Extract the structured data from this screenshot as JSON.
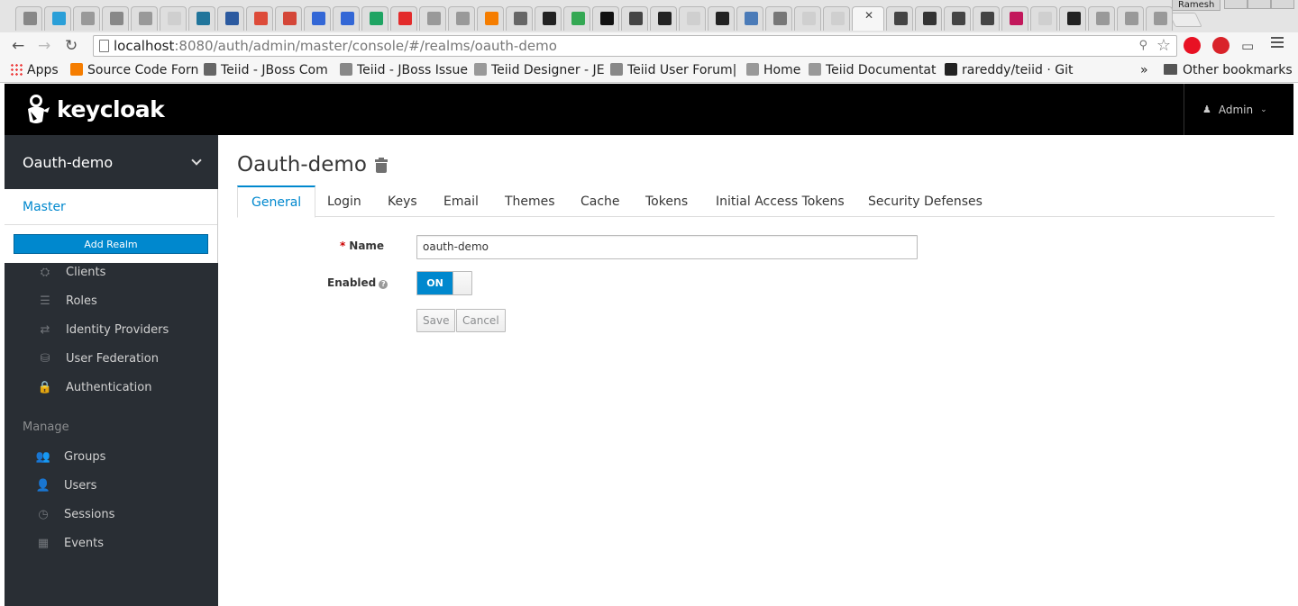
{
  "browser": {
    "profile_name": "Ramesh",
    "tabs": [
      {
        "icon": "jboss-dev-icon",
        "color": "#888888"
      },
      {
        "icon": "zoho-icon",
        "color": "#2a9fd8"
      },
      {
        "icon": "jboss-org-icon",
        "color": "#999999"
      },
      {
        "icon": "jboss-dev-icon",
        "color": "#888888"
      },
      {
        "icon": "jboss-org-icon",
        "color": "#999999"
      },
      {
        "icon": "page-icon",
        "color": "#cfcfcf"
      },
      {
        "icon": "wordpress-icon",
        "color": "#21759b"
      },
      {
        "icon": "bank-icon",
        "color": "#2c5aa0"
      },
      {
        "icon": "google-plus-icon",
        "color": "#dd4b39"
      },
      {
        "icon": "gmail-icon",
        "color": "#d44638"
      },
      {
        "icon": "calendar-icon",
        "color": "#3367d6"
      },
      {
        "icon": "calendar-icon",
        "color": "#3367d6"
      },
      {
        "icon": "drive-icon",
        "color": "#1fa463"
      },
      {
        "icon": "oracle-icon",
        "color": "#e32b2b"
      },
      {
        "icon": "jboss-org-icon",
        "color": "#999999"
      },
      {
        "icon": "jboss-org-icon",
        "color": "#999999"
      },
      {
        "icon": "blogger-icon",
        "color": "#f57d00"
      },
      {
        "icon": "wikipedia-icon",
        "color": "#666666"
      },
      {
        "icon": "info-icon",
        "color": "#222222"
      },
      {
        "icon": "maps-icon",
        "color": "#34a853"
      },
      {
        "icon": "tumblr-icon",
        "color": "#111111"
      },
      {
        "icon": "eap-icon",
        "color": "#444444"
      },
      {
        "icon": "info-icon",
        "color": "#222222"
      },
      {
        "icon": "page-icon",
        "color": "#cfcfcf"
      },
      {
        "icon": "github-icon",
        "color": "#222222"
      },
      {
        "icon": "mvn-icon",
        "color": "#4b7bb8"
      },
      {
        "icon": "gear-icon",
        "color": "#777777"
      },
      {
        "icon": "page-icon",
        "color": "#cfcfcf"
      },
      {
        "icon": "page-icon",
        "color": "#cfcfcf"
      },
      {
        "icon": "active-tab",
        "color": "#f6f6f6"
      },
      {
        "icon": "eap-icon",
        "color": "#444444"
      },
      {
        "icon": "road-icon",
        "color": "#333333"
      },
      {
        "icon": "eap-icon",
        "color": "#444444"
      },
      {
        "icon": "eap-icon",
        "color": "#444444"
      },
      {
        "icon": "feather-icon",
        "color": "#c2185b"
      },
      {
        "icon": "page-icon",
        "color": "#cfcfcf"
      },
      {
        "icon": "github-icon",
        "color": "#222222"
      },
      {
        "icon": "jboss-org-icon",
        "color": "#999999"
      },
      {
        "icon": "jboss-org-icon",
        "color": "#999999"
      },
      {
        "icon": "jboss-org-icon",
        "color": "#999999"
      }
    ],
    "url_host": "localhost",
    "url_rest": ":8080/auth/admin/master/console/#/realms/oauth-demo",
    "extensions": [
      {
        "icon": "opera-icon",
        "color": "#e81123"
      },
      {
        "icon": "adblock-icon",
        "color": "#d9232a"
      }
    ],
    "bookmarks": [
      {
        "label": "Apps",
        "icon": "apps-grid-icon"
      },
      {
        "label": "Source Code Forn",
        "icon": "blogger-icon",
        "color": "#f57d00"
      },
      {
        "label": "Teiid - JBoss Com",
        "icon": "teiid-icon",
        "color": "#666666"
      },
      {
        "label": "Teiid - JBoss Issue",
        "icon": "jboss-dev-icon",
        "color": "#888888"
      },
      {
        "label": "Teiid Designer - JE",
        "icon": "jboss-org-icon",
        "color": "#999999"
      },
      {
        "label": "Teiid User Forum|",
        "icon": "jboss-dev-icon",
        "color": "#888888"
      },
      {
        "label": "Home",
        "icon": "jboss-org-icon",
        "color": "#999999"
      },
      {
        "label": "Teiid Documentat",
        "icon": "jboss-org-icon",
        "color": "#999999"
      },
      {
        "label": "rareddy/teiid · Git",
        "icon": "github-icon",
        "color": "#222222"
      }
    ],
    "overflow_label": "»",
    "other_bookmarks": "Other bookmarks"
  },
  "header": {
    "logo_text": "keycloak",
    "user_label": "Admin"
  },
  "sidebar": {
    "current_realm": "Oauth-demo",
    "dropdown": {
      "realm_item": "Master",
      "add_realm": "Add Realm"
    },
    "configure_items": [
      {
        "label": "Clients",
        "icon": "cubes-icon"
      },
      {
        "label": "Roles",
        "icon": "list-icon"
      },
      {
        "label": "Identity Providers",
        "icon": "exchange-icon"
      },
      {
        "label": "User Federation",
        "icon": "database-icon"
      },
      {
        "label": "Authentication",
        "icon": "lock-icon"
      }
    ],
    "manage_label": "Manage",
    "manage_items": [
      {
        "label": "Groups",
        "icon": "users-icon"
      },
      {
        "label": "Users",
        "icon": "user-icon"
      },
      {
        "label": "Sessions",
        "icon": "clock-icon"
      },
      {
        "label": "Events",
        "icon": "calendar-icon"
      }
    ]
  },
  "main": {
    "title": "Oauth-demo",
    "tabs": [
      "General",
      "Login",
      "Keys",
      "Email",
      "Themes",
      "Cache",
      "Tokens",
      "Initial Access Tokens",
      "Security Defenses"
    ],
    "active_tab": "General",
    "form": {
      "name_label": "Name",
      "required_mark": "*",
      "name_value": "oauth-demo",
      "enabled_label": "Enabled",
      "enabled_state": "ON",
      "save_label": "Save",
      "cancel_label": "Cancel"
    }
  },
  "colors": {
    "accent": "#0088ce",
    "sidebar_bg": "#292e34",
    "header_bg": "#000000"
  }
}
